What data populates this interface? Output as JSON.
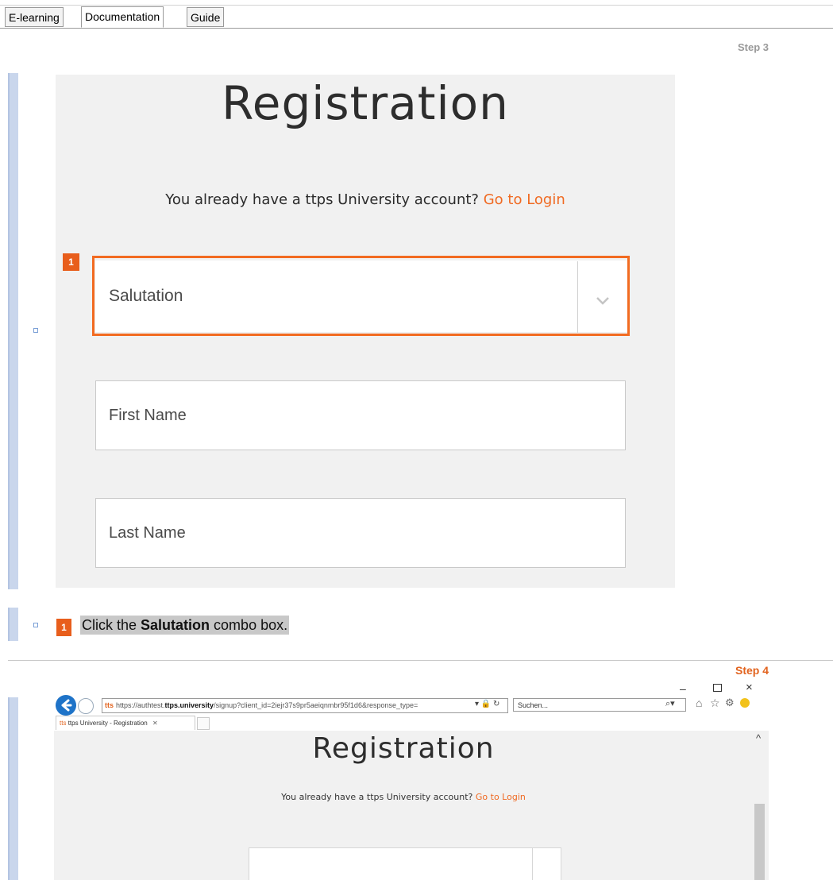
{
  "tabs": [
    {
      "label": "E-learning",
      "active": false
    },
    {
      "label": "Documentation",
      "active": true
    },
    {
      "label": "Guide",
      "active": false
    }
  ],
  "step3": {
    "label": "Step 3",
    "title": "Registration",
    "account_prompt": "You already have a ttps University account?",
    "login_link": "Go to Login",
    "marker": "1",
    "fields": {
      "salutation": "Salutation",
      "first_name": "First Name",
      "last_name": "Last Name"
    },
    "instruction": {
      "marker": "1",
      "prefix": "Click the ",
      "bold": "Salutation",
      "suffix": " combo box."
    }
  },
  "step4": {
    "label": "Step 4",
    "browser": {
      "favicon_text": "tts",
      "url_prefix": "https://authtest.",
      "url_domain": "ttps.university",
      "url_rest": "/signup?client_id=2iejr37s9pr5aeiqnmbr95f1d6&response_type=",
      "search_placeholder": "Suchen...",
      "tab_title": "ttps University - Registration",
      "page_title": "Registration",
      "account_prompt": "You already have a ttps University account?",
      "login_link": "Go to Login"
    }
  },
  "colors": {
    "accent": "#f06a22",
    "panel_bg": "#f1f1f1",
    "left_bar": "#c9d6ec"
  }
}
